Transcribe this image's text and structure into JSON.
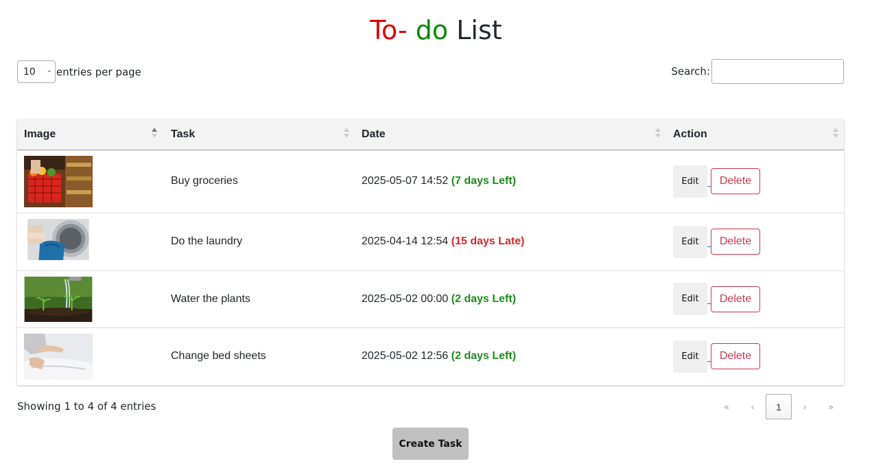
{
  "title": {
    "part1": "To-",
    "part2": "do",
    "part3": "List"
  },
  "colors": {
    "title_red": "#e00000",
    "title_green": "#0a8a0a",
    "left_green": "#1e8a1e",
    "late_red": "#d9262b",
    "delete_red": "#c9364f"
  },
  "length": {
    "value": "10",
    "label": "entries per page"
  },
  "search": {
    "label": "Search:",
    "value": "",
    "placeholder": ""
  },
  "table": {
    "headers": [
      "Image",
      "Task",
      "Date",
      "Action"
    ],
    "rows": [
      {
        "image": "grocery-basket-photo",
        "task": "Buy groceries",
        "date": "2025-05-07 14:52",
        "status": "(7 days Left)",
        "late": false,
        "edit": "Edit",
        "delete": "Delete"
      },
      {
        "image": "laundry-machine-photo",
        "task": "Do the laundry",
        "date": "2025-04-14 12:54",
        "status": "(15 days Late)",
        "late": true,
        "edit": "Edit",
        "delete": "Delete"
      },
      {
        "image": "watering-plants-photo",
        "task": "Water the plants",
        "date": "2025-05-02 00:00",
        "status": "(2 days Left)",
        "late": false,
        "edit": "Edit",
        "delete": "Delete"
      },
      {
        "image": "bed-sheets-photo",
        "task": "Change bed sheets",
        "date": "2025-05-02 12:56",
        "status": "(2 days Left)",
        "late": false,
        "edit": "Edit",
        "delete": "Delete"
      }
    ]
  },
  "info": "Showing 1 to 4 of 4 entries",
  "pagination": {
    "first": "«",
    "prev": "‹",
    "current": "1",
    "next": "›",
    "last": "»"
  },
  "create_button": "Create Task"
}
